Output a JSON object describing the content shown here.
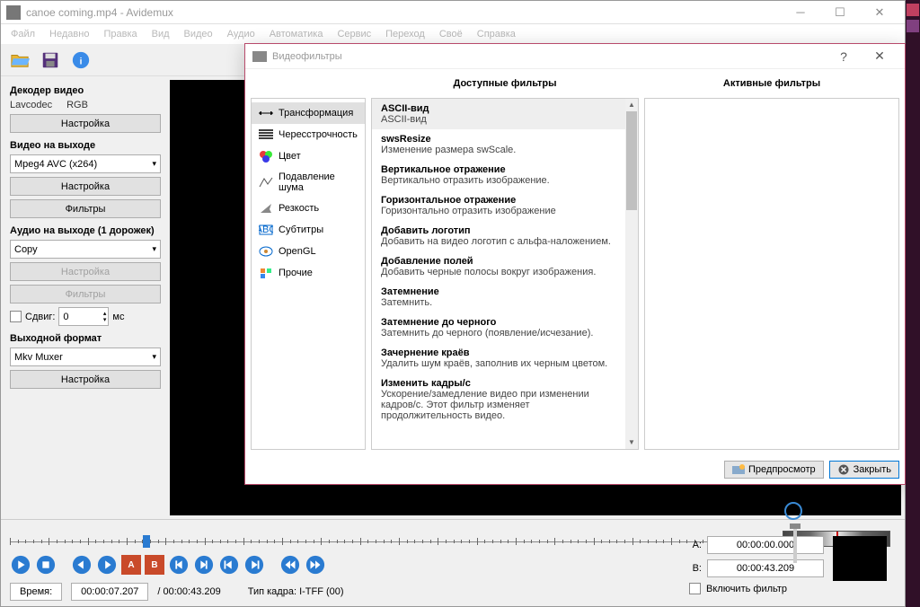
{
  "window": {
    "title": "canoe coming.mp4 - Avidemux",
    "menu": [
      "Файл",
      "Недавно",
      "Правка",
      "Вид",
      "Видео",
      "Аудио",
      "Автоматика",
      "Сервис",
      "Переход",
      "Своё",
      "Справка"
    ]
  },
  "sidebar": {
    "decoder_label": "Декодер видео",
    "decoder_codec": "Lavcodec",
    "decoder_mode": "RGB",
    "settings_btn": "Настройка",
    "video_out_label": "Видео на выходе",
    "video_codec": "Mpeg4 AVC (x264)",
    "filters_btn": "Фильтры",
    "audio_out_label": "Аудио на выходе (1 дорожек)",
    "audio_codec": "Copy",
    "shift_label": "Сдвиг:",
    "shift_value": "0",
    "shift_unit": "мс",
    "output_fmt_label": "Выходной формат",
    "output_fmt": "Mkv Muxer"
  },
  "bottom": {
    "time_label": "Время:",
    "current_time": "00:00:07.207",
    "total_time": "/ 00:00:43.209",
    "frame_type": "Тип кадра:  I-TFF (00)",
    "a_label": "A:",
    "a_time": "00:00:00.000",
    "b_label": "B:",
    "b_time": "00:00:43.209",
    "include_filter": "Включить фильтр"
  },
  "dialog": {
    "title": "Видеофильтры",
    "available_header": "Доступные фильтры",
    "active_header": "Активные фильтры",
    "categories": [
      {
        "label": "Трансформация"
      },
      {
        "label": "Чересстрочность"
      },
      {
        "label": "Цвет"
      },
      {
        "label": "Подавление шума"
      },
      {
        "label": "Резкость"
      },
      {
        "label": "Субтитры"
      },
      {
        "label": "OpenGL"
      },
      {
        "label": "Прочие"
      }
    ],
    "filters": [
      {
        "name": "ASCII-вид",
        "desc": "ASCII-вид"
      },
      {
        "name": "swsResize",
        "desc": "Изменение размера swScale."
      },
      {
        "name": "Вертикальное отражение",
        "desc": "Вертикально отразить изображение."
      },
      {
        "name": "Горизонтальное отражение",
        "desc": "Горизонтально отразить изображение"
      },
      {
        "name": "Добавить логотип",
        "desc": "Добавить на видео логотип с альфа-наложением."
      },
      {
        "name": "Добавление полей",
        "desc": "Добавить черные полосы вокруг изображения."
      },
      {
        "name": "Затемнение",
        "desc": "Затемнить."
      },
      {
        "name": "Затемнение до черного",
        "desc": "Затемнить до черного (появление/исчезание)."
      },
      {
        "name": "Зачернение краёв",
        "desc": "Удалить шум краёв, заполнив их черным цветом."
      },
      {
        "name": "Изменить кадры/с",
        "desc": "Ускорение/замедление видео при изменении кадров/с. Этот фильтр изменяет продолжительность видео."
      }
    ],
    "preview_btn": "Предпросмотр",
    "close_btn": "Закрыть"
  }
}
